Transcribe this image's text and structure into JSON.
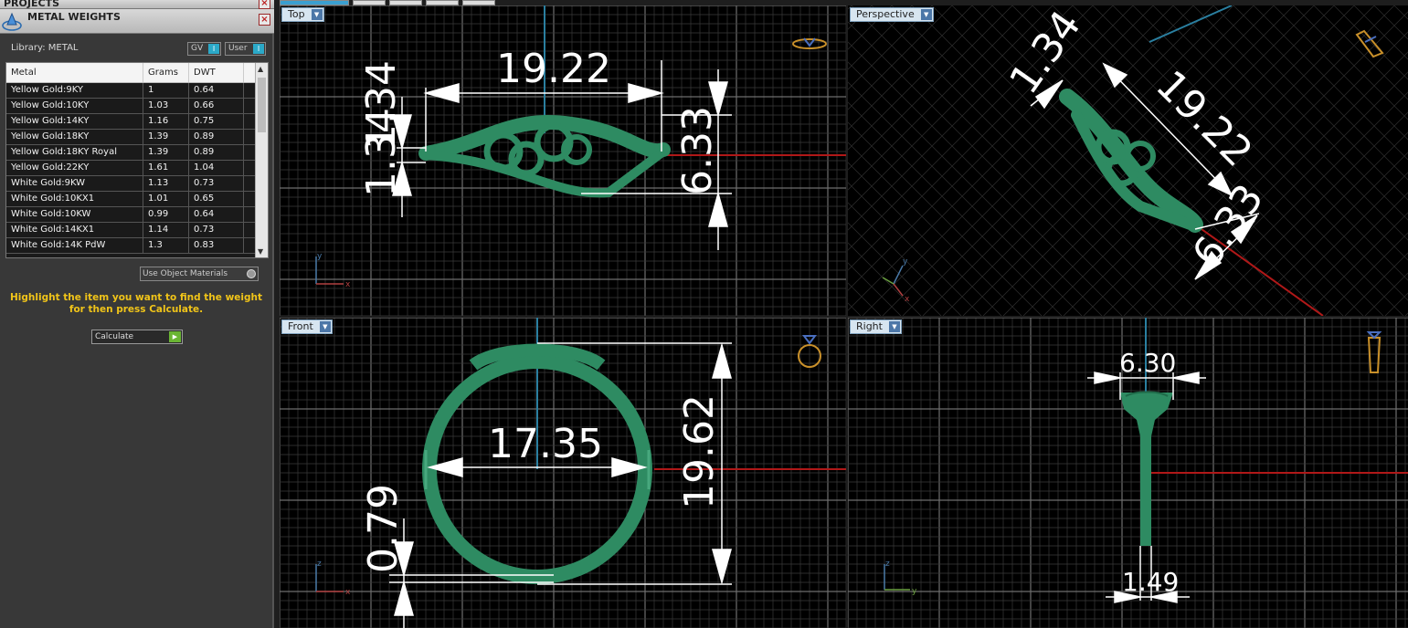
{
  "app": {
    "projects_title": "PROJECTS",
    "panel_title": "METAL WEIGHTS",
    "close_glyph": "×"
  },
  "library": {
    "label": "Library: METAL",
    "gv_label": "GV",
    "user_label": "User",
    "toggle_glyph": "I"
  },
  "table": {
    "columns": [
      "Metal",
      "Grams",
      "DWT"
    ],
    "rows": [
      [
        "Yellow Gold:9KY",
        "1",
        "0.64"
      ],
      [
        "Yellow Gold:10KY",
        "1.03",
        "0.66"
      ],
      [
        "Yellow Gold:14KY",
        "1.16",
        "0.75"
      ],
      [
        "Yellow Gold:18KY",
        "1.39",
        "0.89"
      ],
      [
        "Yellow Gold:18KY Royal",
        "1.39",
        "0.89"
      ],
      [
        "Yellow Gold:22KY",
        "1.61",
        "1.04"
      ],
      [
        "White Gold:9KW",
        "1.13",
        "0.73"
      ],
      [
        "White Gold:10KX1",
        "1.01",
        "0.65"
      ],
      [
        "White Gold:10KW",
        "0.99",
        "0.64"
      ],
      [
        "White Gold:14KX1",
        "1.14",
        "0.73"
      ],
      [
        "White Gold:14K PdW",
        "1.3",
        "0.83"
      ]
    ],
    "scroll_up_glyph": "▲",
    "scroll_down_glyph": "▼"
  },
  "options": {
    "use_object_materials": "Use Object Materials"
  },
  "hint": "Highlight the item you want to find the weight for then press Calculate.",
  "calculate": {
    "label": "Calculate",
    "glyph": "▶"
  },
  "viewports": {
    "top": {
      "label": "Top",
      "dims": [
        "19.22",
        "1.34",
        "1.34",
        "6.33"
      ]
    },
    "perspective": {
      "label": "Perspective",
      "dims": [
        "1.34",
        "19.22",
        "6.33"
      ]
    },
    "front": {
      "label": "Front",
      "dims": [
        "17.35",
        "19.62",
        "0.79"
      ]
    },
    "right": {
      "label": "Right",
      "dims": [
        "6.30",
        "1.49"
      ]
    },
    "dropdown_glyph": "▼",
    "axis_labels": {
      "x": "x",
      "y": "y",
      "z": "z"
    }
  },
  "colors": {
    "model_green": "#2e8b62",
    "grid_major": "#6e6e6e",
    "grid_minor": "#3a3a3a",
    "axis_red": "#b01818",
    "axis_blue": "#2a7fa0",
    "hint_yellow": "#f0c419"
  }
}
